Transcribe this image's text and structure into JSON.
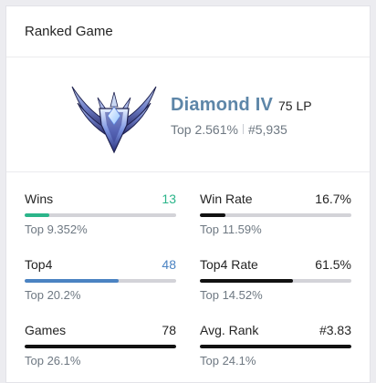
{
  "header": {
    "title": "Ranked Game"
  },
  "tier": {
    "emblem_icon": "diamond-rank-emblem",
    "name": "Diamond IV",
    "lp": "75 LP",
    "top_percent": "Top 2.561%",
    "rank_number": "#5,935"
  },
  "colors": {
    "tier": "#5d86a8",
    "green": "#2bb58a",
    "blue": "#4b83c2",
    "dark": "#111111"
  },
  "stats": {
    "wins": {
      "label": "Wins",
      "value": "13",
      "sub": "Top 9.352%",
      "fill": 0.16
    },
    "win_rate": {
      "label": "Win Rate",
      "value": "16.7%",
      "sub": "Top 11.59%",
      "fill": 0.167
    },
    "top4": {
      "label": "Top4",
      "value": "48",
      "sub": "Top 20.2%",
      "fill": 0.62
    },
    "top4_rate": {
      "label": "Top4 Rate",
      "value": "61.5%",
      "sub": "Top 14.52%",
      "fill": 0.615
    },
    "games": {
      "label": "Games",
      "value": "78",
      "sub": "Top 26.1%",
      "fill": 1.0
    },
    "avg_rank": {
      "label": "Avg. Rank",
      "value": "#3.83",
      "sub": "Top 24.1%",
      "fill": 1.0
    }
  }
}
